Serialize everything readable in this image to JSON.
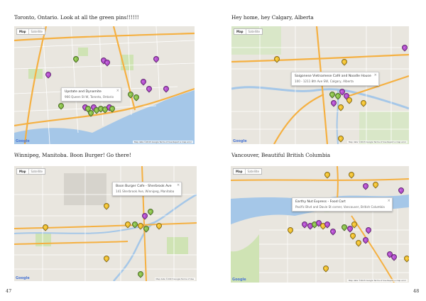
{
  "pages": {
    "left_number": "47",
    "right_number": "48"
  },
  "maps": [
    {
      "caption": "Toronto, Ontario. Look at all the green pins!!!!!!",
      "map_type": [
        "Map",
        "Satellite"
      ],
      "info_title": "Upstate and Dynamite",
      "info_address": "966 Queen St W, Toronto, Ontario",
      "logo": "Google",
      "attribution": "Map data ©2015 Google   Terms of Use   Report a map error"
    },
    {
      "caption": "Hey home, hey Calgary, Alberta",
      "map_type": [
        "Map",
        "Satellite"
      ],
      "info_title": "Saigonese Vietnamese Café and Noodle House",
      "info_address": "100 - 1211 8th Ave SW, Calgary, Alberta",
      "logo": "Google",
      "attribution": "Map data ©2015 Google   Terms of Use   Report a map error"
    },
    {
      "caption": "Winnipeg, Manitoba. Boon Burger! Go there!",
      "map_type": [
        "Map",
        "Satellite"
      ],
      "info_title": "Boon Burger Cafe - Sherbrook Ave",
      "info_address": "141 Sherbrook Ave, Winnipeg, Manitoba",
      "logo": "Google",
      "attribution": "Map data ©2015 Google   Terms of Use"
    },
    {
      "caption": "Vancouver, Beautiful British Columbia",
      "map_type": [
        "Map",
        "Satellite"
      ],
      "info_title": "Earthy Nut Express - Food Cart",
      "info_address": "Pacific Blvd and Davie St corner, Vancouver, British Columbia",
      "logo": "Google",
      "attribution": "Map data ©2015 Google   Terms of Use   Report a map error"
    }
  ],
  "colors": {
    "pin_green": "#8bc34a",
    "pin_purple": "#b64fd1",
    "pin_yellow": "#f4c430",
    "water": "#a5c7e8",
    "land": "#e9e6df",
    "highway": "#f5b041"
  }
}
